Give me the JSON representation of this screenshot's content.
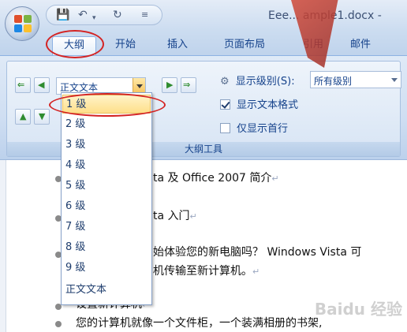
{
  "window": {
    "title": "Eee... ample1.docx -"
  },
  "qat": {
    "save_icon": "save-icon",
    "undo_icon": "undo-icon",
    "redo_icon": "redo-icon",
    "customize_icon": "customize-icon"
  },
  "tabs": [
    {
      "label": "大纲",
      "active": true
    },
    {
      "label": "开始"
    },
    {
      "label": "插入"
    },
    {
      "label": "页面布局"
    },
    {
      "label": "引用"
    },
    {
      "label": "邮件"
    }
  ],
  "ribbon": {
    "group_label": "大纲工具",
    "level_select": {
      "value": "正文文本"
    },
    "show_level": {
      "label": "显示级别(S):",
      "value": "所有级别"
    },
    "show_text_format": {
      "label": "显示文本格式",
      "checked": true
    },
    "show_first_line_only": {
      "label": "仅显示首行",
      "checked": false
    }
  },
  "dropdown": {
    "items": [
      "1 级",
      "2 级",
      "3 级",
      "4 级",
      "5 级",
      "6 级",
      "7 级",
      "8 级",
      "9 级",
      "正文文本"
    ],
    "selected_index": 0
  },
  "document": {
    "lines": [
      "ta 及 Office 2007 简介",
      "ta 入门",
      "始体验您的新电脑吗？ Windows Vista 可",
      "机传输至新计算机。",
      "设置新计算机",
      "您的计算机就像一个文件柜，一个装满相册的书架,"
    ],
    "paragraph_mark": "↵"
  },
  "watermark": "Baidu 经验",
  "colors": {
    "accent": "#15428b",
    "annotation": "#d42323",
    "selected": "#fedf8a"
  }
}
